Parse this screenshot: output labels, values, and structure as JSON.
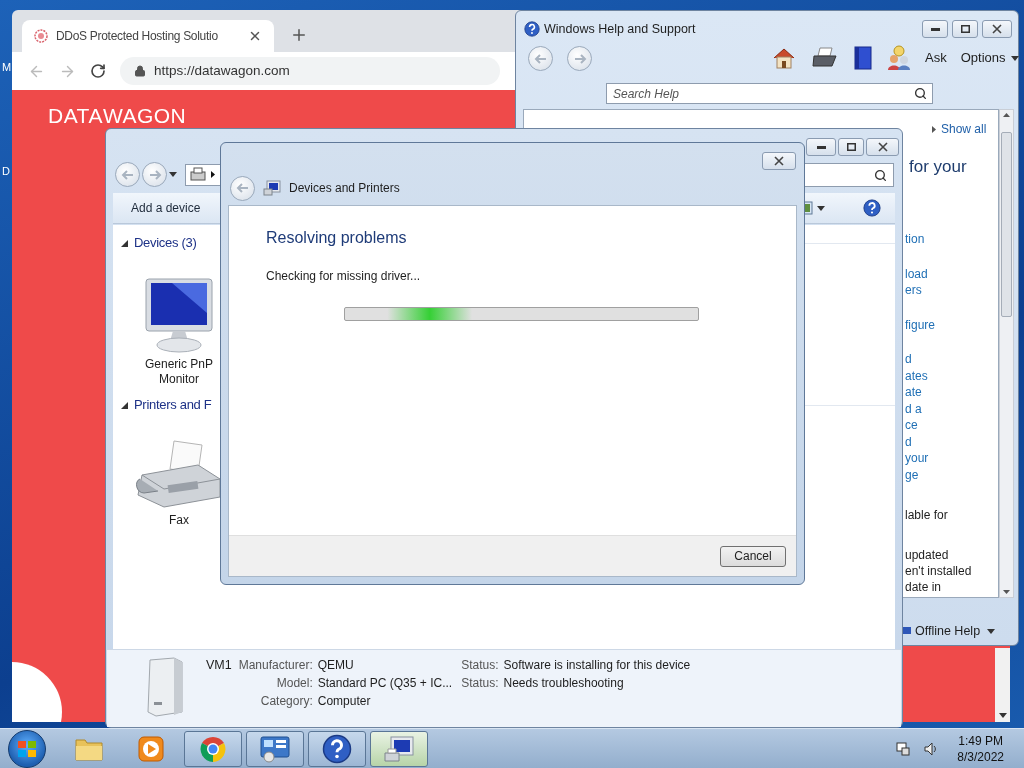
{
  "desktop": {
    "icon_labels": [
      "M",
      "D"
    ]
  },
  "browser": {
    "tabs": [
      {
        "title": "DDoS Protected Hosting Solutio",
        "selected": true
      }
    ],
    "url": "https://datawagon.com",
    "logo": "**DATA**WAGON"
  },
  "help_window": {
    "title": "Windows Help and Support",
    "ask": "Ask",
    "options": "Options",
    "search": {
      "placeholder": "Search Help"
    },
    "show_all": "Show all",
    "heading_fragment": "for your",
    "link_groups": [
      [
        "tion"
      ],
      [
        "load",
        "ers"
      ],
      [
        "figure"
      ],
      [
        "d",
        "ates",
        "ate",
        "d a",
        "ce",
        "d",
        "your",
        "ge"
      ]
    ],
    "text_groups": [
      [
        "lable for"
      ],
      [
        "updated",
        "en't installed",
        "date in"
      ]
    ],
    "footer": "Offline Help"
  },
  "devices_window": {
    "toolbar": [
      "Add a device"
    ],
    "sections": [
      {
        "title": "Devices (3)",
        "expanded": true,
        "items": [
          {
            "label": "Generic PnP Monitor",
            "kind": "monitor"
          }
        ]
      },
      {
        "title": "Printers and F",
        "expanded": true,
        "items": [
          {
            "label": "Fax",
            "kind": "fax"
          }
        ]
      }
    ],
    "details": {
      "name": "VM1",
      "fields": [
        {
          "label": "Manufacturer:",
          "value": "QEMU"
        },
        {
          "label": "Model:",
          "value": "Standard PC (Q35 + IC..."
        },
        {
          "label": "Category:",
          "value": "Computer"
        }
      ],
      "statuses": [
        {
          "label": "Status:",
          "value": "Software is installing for this device"
        },
        {
          "label": "Status:",
          "value": "Needs troubleshooting"
        }
      ]
    }
  },
  "dialog": {
    "title": "Devices and Printers",
    "heading": "Resolving problems",
    "message": "Checking for missing driver...",
    "progress": {
      "indeterminate": true
    },
    "button": "Cancel"
  },
  "taskbar": {
    "buttons": [
      {
        "kind": "folder",
        "running": false,
        "selected": false
      },
      {
        "kind": "media",
        "running": false,
        "selected": false
      },
      {
        "kind": "browser",
        "running": true,
        "selected": false
      },
      {
        "kind": "control-panel",
        "running": true,
        "selected": false
      },
      {
        "kind": "help",
        "running": true,
        "selected": false
      },
      {
        "kind": "devices",
        "running": true,
        "selected": true
      }
    ],
    "time": "1:49 PM",
    "date": "8/3/2022"
  }
}
